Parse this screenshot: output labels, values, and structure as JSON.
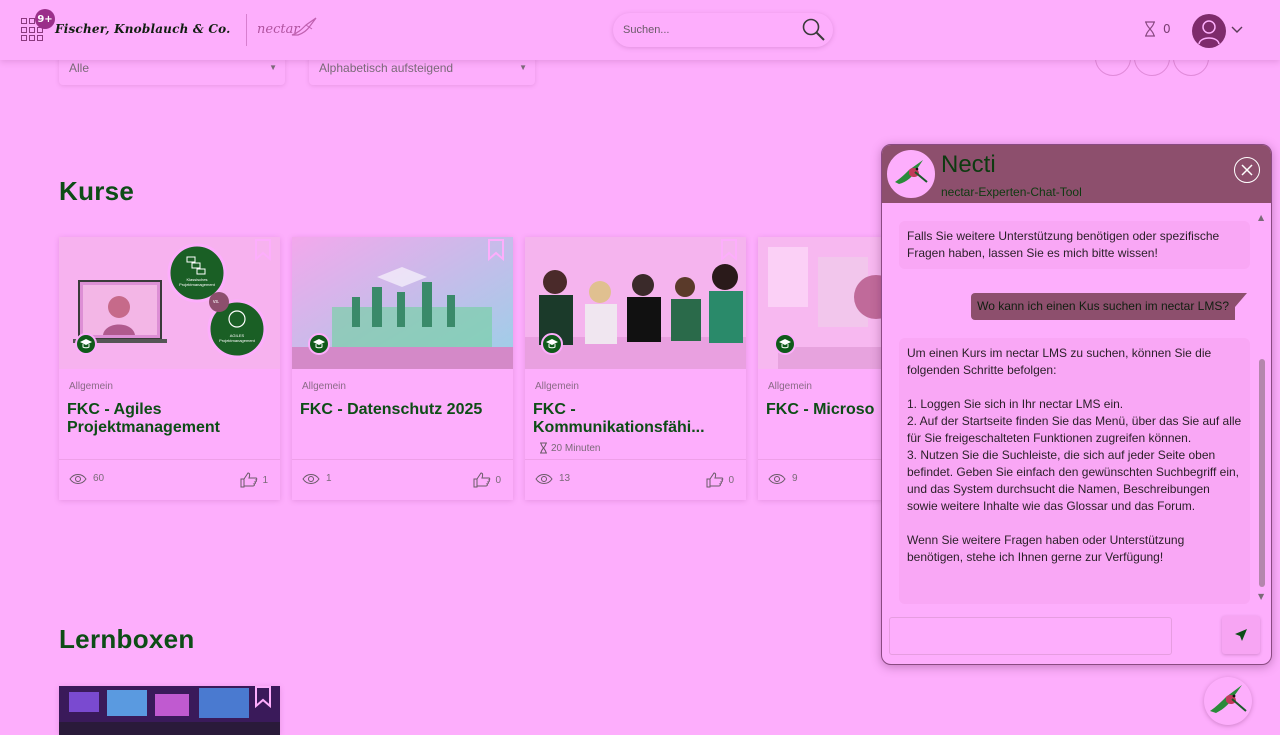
{
  "header": {
    "notification_count": "9+",
    "company_name": "Fischer, Knoblauch & Co.",
    "product_logo": "nectar",
    "search_placeholder": "Suchen...",
    "timer_count": "0"
  },
  "filters": {
    "category_value": "Alle",
    "sort_value": "Alphabetisch aufsteigend"
  },
  "sections": {
    "courses_title": "Kurse",
    "learnboxes_title": "Lernboxen"
  },
  "courses": [
    {
      "category": "Allgemein",
      "title": "FKC - Agiles Projektmanagement",
      "duration": "",
      "views": "60",
      "likes": "1",
      "image_label_1": "Klassisches Projektmanagement",
      "image_label_vs": "vs.",
      "image_label_2": "AGILES Projektmanagement"
    },
    {
      "category": "Allgemein",
      "title": "FKC - Datenschutz 2025",
      "duration": "",
      "views": "1",
      "likes": "0"
    },
    {
      "category": "Allgemein",
      "title": "FKC - Kommunikationsfähi...",
      "duration": "20 Minuten",
      "views": "13",
      "likes": "0"
    },
    {
      "category": "Allgemein",
      "title": "FKC - Microso",
      "duration": "",
      "views": "9",
      "likes": ""
    }
  ],
  "chat": {
    "name": "Necti",
    "subtitle": "nectar-Experten-Chat-Tool",
    "messages": [
      {
        "role": "bot",
        "text": "Falls Sie weitere Unterstützung benötigen oder spezifische Fragen haben, lassen Sie es mich bitte wissen!"
      },
      {
        "role": "user",
        "text": "Wo kann ich einen Kus suchen im nectar LMS?"
      },
      {
        "role": "bot",
        "text": "Um einen Kurs im nectar LMS zu suchen, können Sie die folgenden Schritte befolgen:\n\n1. Loggen Sie sich in Ihr nectar LMS ein.\n2. Auf der Startseite finden Sie das Menü, über das Sie auf alle für Sie freigeschalteten Funktionen zugreifen können.\n3. Nutzen Sie die Suchleiste, die sich auf jeder Seite oben befindet. Geben Sie einfach den gewünschten Suchbegriff ein, und das System durchsucht die Namen, Beschreibungen sowie weitere Inhalte wie das Glossar und das Forum.\n\nWenn Sie weitere Fragen haben oder Unterstützung benötigen, stehe ich Ihnen gerne zur Verfügung!"
      }
    ]
  },
  "colors": {
    "accent_green": "#0d4d16",
    "page_bg": "#fdaefc",
    "chat_header": "#8d4f6d"
  },
  "icons": [
    "apps-grid-icon",
    "search-icon",
    "hourglass-icon",
    "user-avatar-icon",
    "chevron-down-icon",
    "bookmark-icon",
    "graduation-cap-icon",
    "eye-icon",
    "thumbs-up-icon",
    "close-icon",
    "send-icon",
    "hummingbird-icon"
  ]
}
